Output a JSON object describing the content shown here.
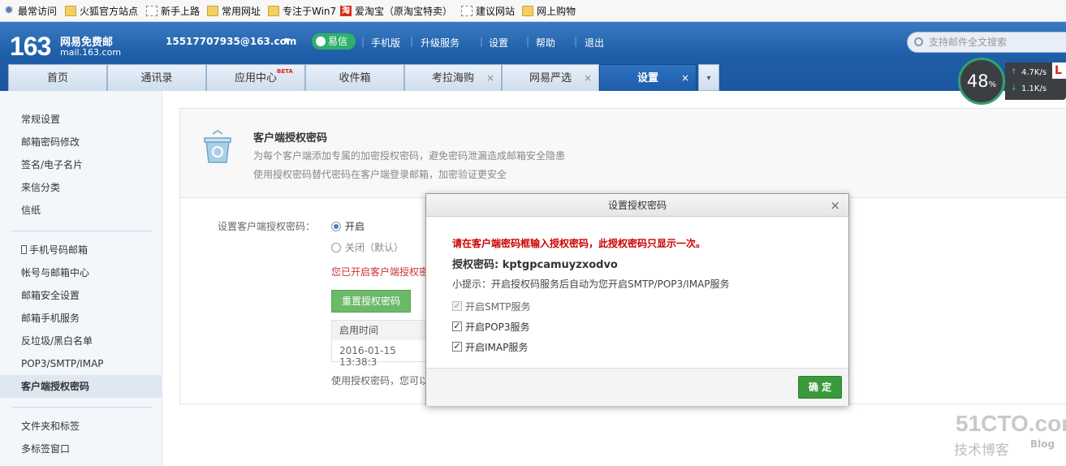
{
  "bookmarks": [
    {
      "label": "最常访问",
      "icon": "star-icon"
    },
    {
      "label": "火狐官方站点",
      "icon": "folder-icon"
    },
    {
      "label": "新手上路",
      "icon": "page-icon"
    },
    {
      "label": "常用网址",
      "icon": "folder-icon"
    },
    {
      "label": "专注于Win7",
      "icon": "folder-icon"
    },
    {
      "label": "爱淘宝（原淘宝特卖）",
      "icon": "aitaobao-icon"
    },
    {
      "label": "建议网站",
      "icon": "page-icon"
    },
    {
      "label": "网上购物",
      "icon": "folder-icon"
    }
  ],
  "header": {
    "logo_num": "163",
    "logo_name": "网易免费邮",
    "logo_url": "mail.163.com",
    "account": "15517707935@163.com",
    "yixin": "易信",
    "links": [
      "手机版",
      "升级服务",
      "设置",
      "帮助",
      "退出"
    ],
    "search_placeholder": "支持邮件全文搜索"
  },
  "tabs": [
    {
      "label": "首页"
    },
    {
      "label": "通讯录"
    },
    {
      "label": "应用中心",
      "badge": "BETA"
    },
    {
      "label": "收件箱"
    },
    {
      "label": "考拉海购",
      "close": "×"
    },
    {
      "label": "网易严选",
      "close": "×"
    },
    {
      "label": "设置",
      "close": "×",
      "active": true
    }
  ],
  "speed": {
    "percent": "48",
    "unit": "%",
    "up": "4.7K/s",
    "down": "1.1K/s"
  },
  "side_tag": "L",
  "sidebar": {
    "group1": [
      "常规设置",
      "邮箱密码修改",
      "签名/电子名片",
      "来信分类",
      "信纸"
    ],
    "group2": [
      "手机号码邮箱",
      "帐号与邮箱中心",
      "邮箱安全设置",
      "邮箱手机服务",
      "反垃圾/黑白名单",
      "POP3/SMTP/IMAP",
      "客户端授权密码"
    ],
    "group3": [
      "文件夹和标签",
      "多标签窗口"
    ]
  },
  "panel": {
    "title": "客户端授权密码",
    "desc1": "为每个客户端添加专属的加密授权密码，避免密码泄漏造成邮箱安全隐患",
    "desc2": "使用授权密码替代密码在客户端登录邮箱，加密验证更安全",
    "setting_label": "设置客户端授权密码：",
    "opt_on": "开启",
    "opt_off": "关闭（默认）",
    "enabled_msg": "您已开启客户端授权密",
    "reset_btn": "重置授权密码",
    "table_header": "启用时间",
    "table_value": "2016-01-15 13:38:3",
    "use_msg": "使用授权密码，您可以"
  },
  "dialog": {
    "title": "设置授权密码",
    "close": "×",
    "warn": "请在客户端密码框输入授权密码，此授权密码只显示一次。",
    "pwd_label": "授权密码: kptgpcamuyzxodvo",
    "tip": "小提示：开启授权码服务后自动为您开启SMTP/POP3/IMAP服务",
    "options": [
      "开启SMTP服务",
      "开启POP3服务",
      "开启IMAP服务"
    ],
    "ok": "确 定"
  },
  "watermark": {
    "line1": "51CTO.com",
    "line2": "技术博客",
    "line3": "Blog"
  }
}
